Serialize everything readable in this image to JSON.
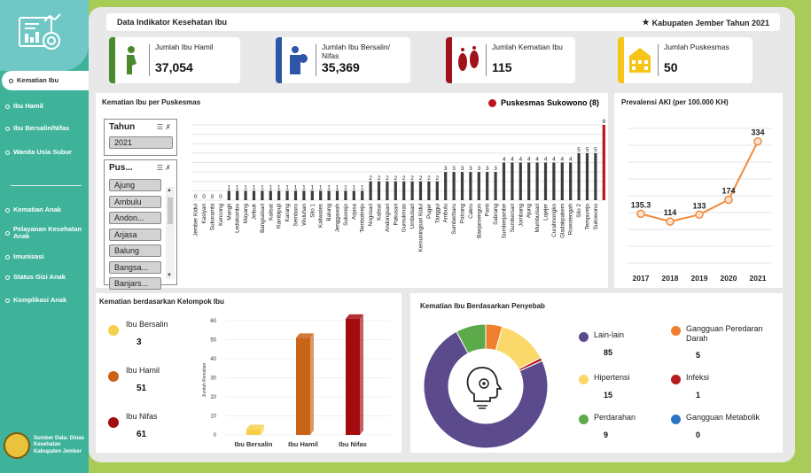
{
  "sidebar": {
    "items": [
      {
        "label": "Kematian Ibu",
        "active": true
      },
      {
        "label": "Ibu Hamil"
      },
      {
        "label": "Ibu Bersalin/Nifas"
      },
      {
        "label": "Wanita Usia Subur"
      },
      {
        "label": "Kematian Anak"
      },
      {
        "label": "Pelayanan Kesehatan Anak"
      },
      {
        "label": "Imunisasi"
      },
      {
        "label": "Status Gizi Anak"
      },
      {
        "label": "Komplikasi Anak"
      }
    ],
    "source": "Sumber Data: Dinas Kesehatan Kabupaten Jember"
  },
  "header": {
    "title": "Data Indikator Kesehatan Ibu",
    "region": "Kabupaten Jember Tahun 2021"
  },
  "kpis": [
    {
      "label": "Jumlah Ibu Hamil",
      "value": "37,054",
      "color": "#4a8a2c",
      "icon": "pregnant-woman-icon"
    },
    {
      "label": "Jumlah Ibu Bersalin/ Nifas",
      "value": "35,369",
      "color": "#2d56a6",
      "icon": "mother-baby-icon"
    },
    {
      "label": "Jumlah Kematian Ibu",
      "value": "115",
      "color": "#a0121c",
      "icon": "footprints-icon"
    },
    {
      "label": "Jumlah Puskesmas",
      "value": "50",
      "color": "#f5c518",
      "icon": "building-icon"
    }
  ],
  "puskesmas_panel": {
    "title": "Kematian Ibu per Puskesmas",
    "legend": "Puskesmas Sukowono (8)",
    "year_slicer": {
      "title": "Tahun",
      "items": [
        "2021"
      ]
    },
    "pus_slicer": {
      "title": "Pus...",
      "items": [
        "Ajung",
        "Ambulu",
        "Andon...",
        "Arjasa",
        "Balung",
        "Bangsa...",
        "Banjars..."
      ]
    }
  },
  "chart_data": [
    {
      "type": "bar",
      "title": "Kematian Ibu per Puskesmas",
      "categories": [
        "Jember Kidul",
        "Kasiyan",
        "Sukorambi",
        "Kencong",
        "Mangli",
        "Ledokombo",
        "Mayang",
        "Jelbuk",
        "Bangsalsari",
        "Kalisat",
        "Rambipuji",
        "Karang",
        "Semboro",
        "Wuluhan",
        "Silo 1",
        "Kaliwates",
        "Balung",
        "Jenggawah",
        "Sukorejo",
        "Arjasa",
        "Tembokrejo",
        "Nogosari",
        "Kalisat",
        "Andongsari",
        "Pakusari",
        "Gumukmas",
        "Umbulsari",
        "Kemuningsari Kidul",
        "Puger",
        "Tanggul",
        "Ambulu",
        "Sumberbaru",
        "Patrang",
        "Cakru",
        "Banjarsengon",
        "Panti",
        "Sabrang",
        "Sumberjambe",
        "Sumbersari",
        "Jombang",
        "Ajung",
        "Mumbulsari",
        "Lojejer",
        "Curahnongko",
        "Gladakpakem",
        "Rowotengah",
        "Silo 2",
        "Tempurejo",
        "Sukowono"
      ],
      "values": [
        0,
        0,
        0,
        0,
        1,
        1,
        1,
        1,
        1,
        1,
        1,
        1,
        1,
        1,
        1,
        1,
        1,
        1,
        1,
        1,
        1,
        2,
        2,
        2,
        2,
        2,
        2,
        2,
        2,
        2,
        3,
        3,
        3,
        3,
        3,
        3,
        3,
        4,
        4,
        4,
        4,
        4,
        4,
        4,
        4,
        4,
        5,
        5,
        5,
        8
      ],
      "highlight": "Sukowono",
      "highlight_color": "#c1121f",
      "bar_color": "#3c3c3c",
      "grid": true
    },
    {
      "type": "line",
      "title": "Prevalensi AKI (per 100.000 KH)",
      "x": [
        "2017",
        "2018",
        "2019",
        "2020",
        "2021"
      ],
      "values": [
        135.3,
        114,
        133,
        174,
        334
      ],
      "color": "#f08a3c",
      "grid": true
    },
    {
      "type": "bar",
      "title": "Kematian berdasarkan Kelompok Ibu",
      "categories": [
        "Ibu Bersalin",
        "Ibu Hamil",
        "Ibu Nifas"
      ],
      "values": [
        3,
        51,
        61
      ],
      "colors": [
        "#f7d04a",
        "#c96316",
        "#a30b0f"
      ],
      "ylabel": "Jumlah Kematian",
      "ylim": [
        0,
        60
      ],
      "yticks": [
        0,
        10,
        20,
        30,
        40,
        50,
        60
      ]
    },
    {
      "type": "pie",
      "title": "Kematian Ibu Berdasarkan Penyebab",
      "labels": [
        "Lain-lain",
        "Gangguan Peredaran Darah",
        "Hipertensi",
        "Infeksi",
        "Perdarahan",
        "Gangguan Metabolik"
      ],
      "values": [
        85,
        5,
        15,
        1,
        9,
        0
      ],
      "colors": [
        "#5b4a8c",
        "#f07f2e",
        "#fbd86a",
        "#b51c1c",
        "#5daa4b",
        "#2b75c4"
      ],
      "center_icon": "head-lightbulb-icon"
    }
  ],
  "group_panel": {
    "title": "Kematian berdasarkan Kelompok Ibu",
    "items": [
      {
        "label": "Ibu Bersalin",
        "value": "3",
        "color": "#f7d04a"
      },
      {
        "label": "Ibu Hamil",
        "value": "51",
        "color": "#c96316"
      },
      {
        "label": "Ibu Nifas",
        "value": "61",
        "color": "#a30b0f"
      }
    ]
  },
  "cause_panel": {
    "title": "Kematian Ibu Berdasarkan Penyebab",
    "items": [
      {
        "label": "Lain-lain",
        "value": "85",
        "color": "#5b4a8c"
      },
      {
        "label": "Gangguan Peredaran Darah",
        "value": "5",
        "color": "#f07f2e"
      },
      {
        "label": "Hipertensi",
        "value": "15",
        "color": "#fbd86a"
      },
      {
        "label": "Infeksi",
        "value": "1",
        "color": "#b51c1c"
      },
      {
        "label": "Perdarahan",
        "value": "9",
        "color": "#5daa4b"
      },
      {
        "label": "Gangguan Metabolik",
        "value": "0",
        "color": "#2b75c4"
      }
    ]
  },
  "aki_panel": {
    "title": "Prevalensi AKI (per 100.000 KH)"
  }
}
